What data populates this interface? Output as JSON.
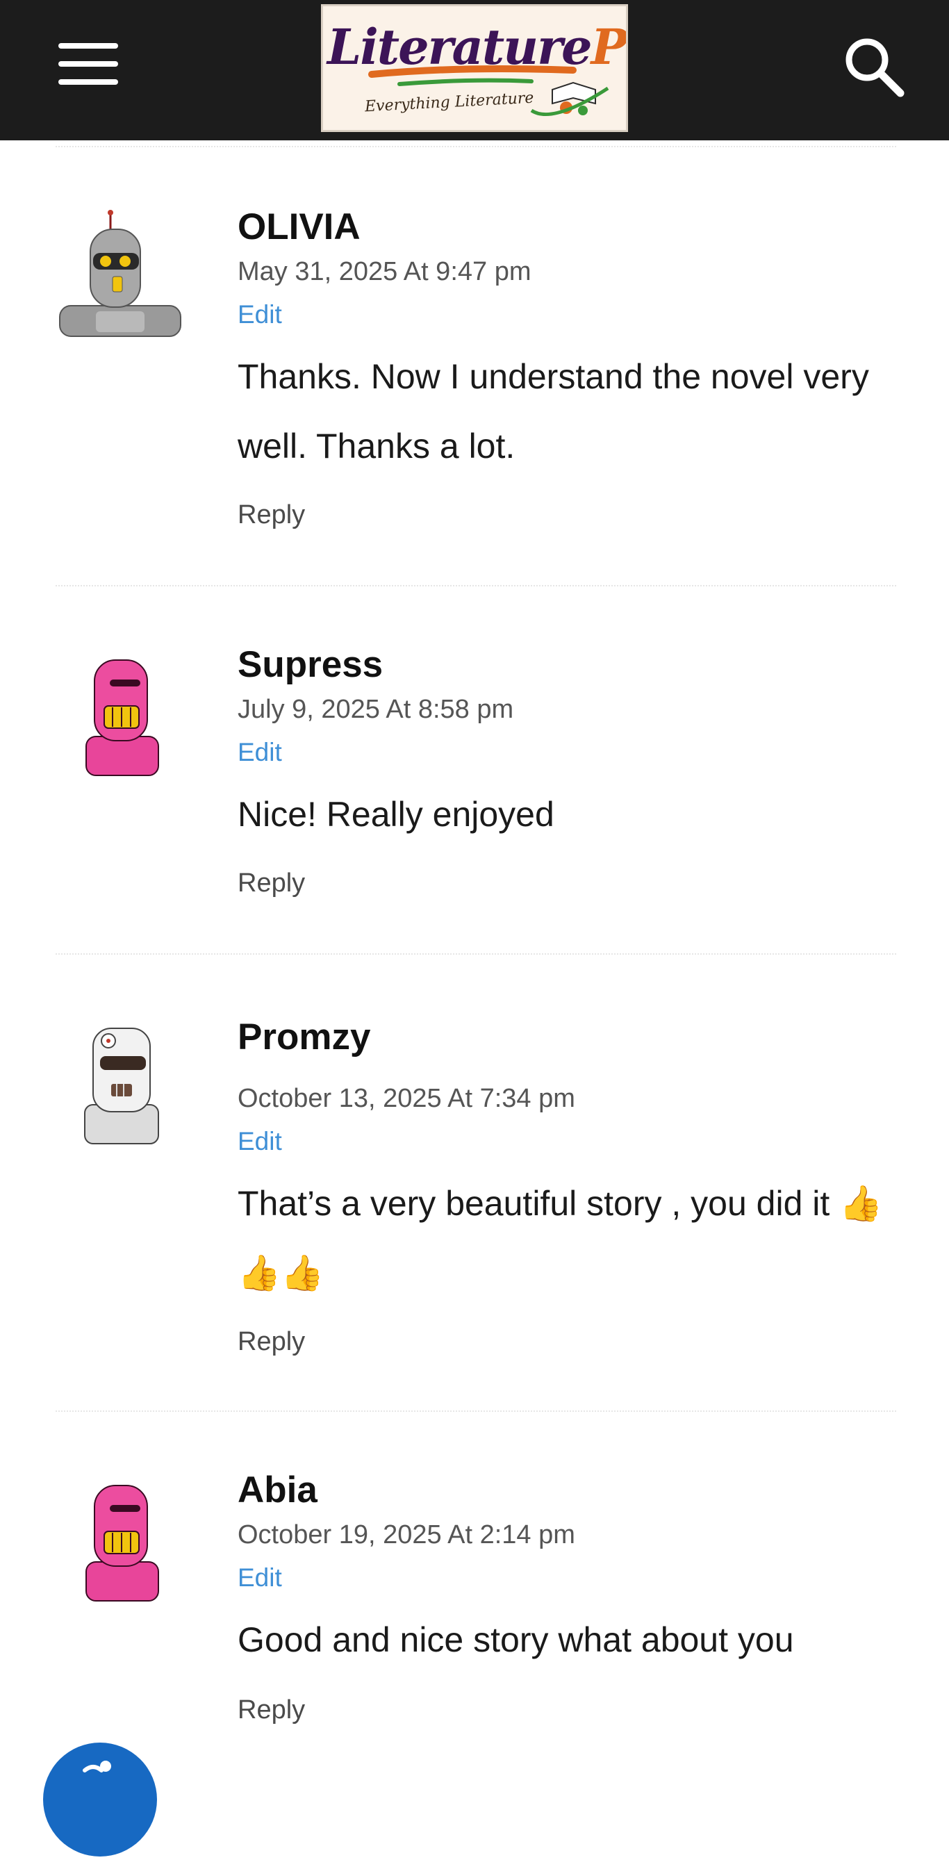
{
  "header": {
    "menu_icon": "hamburger-menu-icon",
    "logo": {
      "title_part1": "Literature",
      "title_part2": "Padi",
      "tagline": "Everything Literature",
      "colors": {
        "title": "#3c1457",
        "accent": "#e06a1f",
        "background": "#fbf2e8"
      }
    },
    "search_icon": "search-icon",
    "background": "#1c1c1c"
  },
  "comments": [
    {
      "author": "OLIVIA",
      "date": "May 31, 2025 At 9:47 pm",
      "edit_label": "Edit",
      "text": "Thanks. Now I understand the novel very well. Thanks a lot.",
      "reply_label": "Reply",
      "avatar": "gray-robot-avatar"
    },
    {
      "author": "Supress",
      "date": "July 9, 2025 At 8:58 pm",
      "edit_label": "Edit",
      "text": "Nice! Really enjoyed",
      "reply_label": "Reply",
      "avatar": "pink-robot-avatar"
    },
    {
      "author": "Promzy",
      "date": "October 13, 2025 At 7:34 pm",
      "edit_label": "Edit",
      "text": "That’s a very beautiful story , you did it 👍👍👍",
      "reply_label": "Reply",
      "avatar": "white-robot-avatar"
    },
    {
      "author": "Abia",
      "date": "October 19, 2025 At 2:14 pm",
      "edit_label": "Edit",
      "text": "Good and nice story what about you",
      "reply_label": "Reply",
      "avatar": "pink-robot-avatar"
    }
  ],
  "accessibility_button": {
    "icon": "accessibility-icon",
    "color": "#1769c2"
  },
  "colors": {
    "edit_link": "#3f8fd6",
    "meta_text": "#555555"
  }
}
